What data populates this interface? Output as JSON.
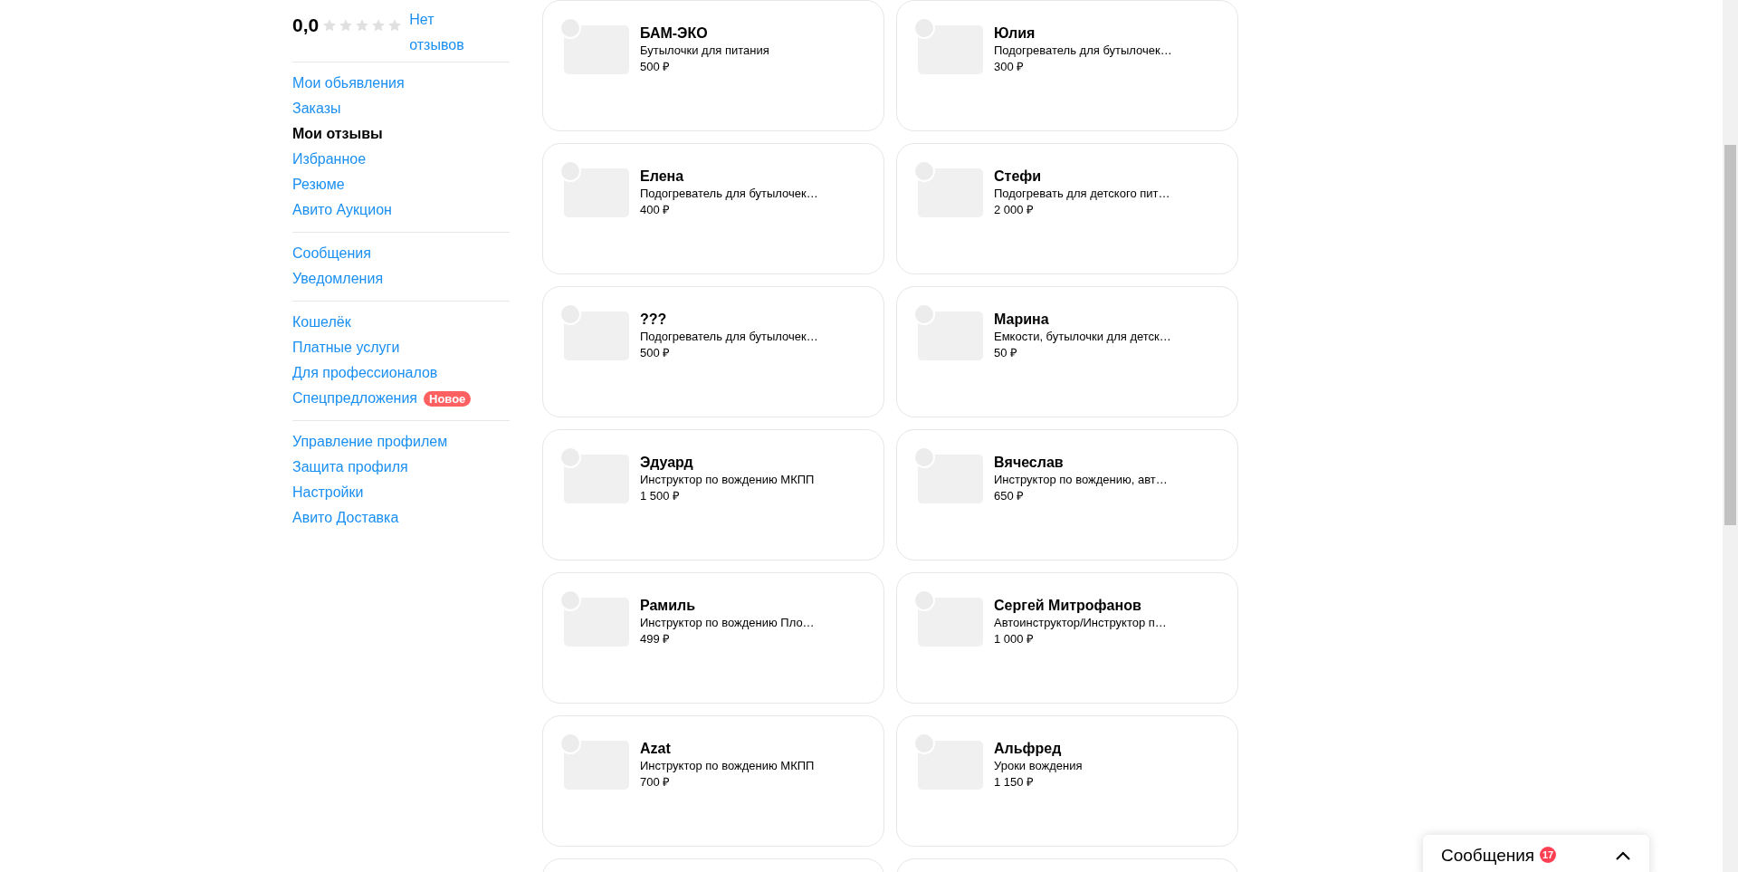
{
  "profile": {
    "rating": "0,0",
    "stars": 0,
    "reviews_link": "Нет отзывов"
  },
  "menu_groups": [
    {
      "items": [
        {
          "label": "Мои обьявления",
          "selected": false
        },
        {
          "label": "Заказы",
          "selected": false
        },
        {
          "label": "Мои отзывы",
          "selected": true
        },
        {
          "label": "Избранное",
          "selected": false
        },
        {
          "label": "Резюме",
          "selected": false
        },
        {
          "label": "Авито Аукцион",
          "selected": false
        }
      ]
    },
    {
      "items": [
        {
          "label": "Сообщения",
          "selected": false
        },
        {
          "label": "Уведомления",
          "selected": false
        }
      ]
    },
    {
      "items": [
        {
          "label": "Кошелёк",
          "selected": false
        },
        {
          "label": "Платные услуги",
          "selected": false
        },
        {
          "label": "Для профессионалов",
          "selected": false
        },
        {
          "label": "Спецпредложения",
          "selected": false,
          "badge": "Новое"
        }
      ]
    },
    {
      "items": [
        {
          "label": "Управление профилем",
          "selected": false
        },
        {
          "label": "Защита профиля",
          "selected": false
        },
        {
          "label": "Настройки",
          "selected": false
        },
        {
          "label": "Авито Доставка",
          "selected": false
        }
      ]
    }
  ],
  "deals": [
    {
      "name": "БАМ-ЭКО",
      "item": "Бутылочки для питания",
      "price": "500 ₽"
    },
    {
      "name": "Юлия",
      "item": "Подогреватель для бутылочек…",
      "price": "300 ₽"
    },
    {
      "name": "Елена",
      "item": "Подогреватель для бутылочек…",
      "price": "400 ₽"
    },
    {
      "name": "Стефи",
      "item": "Подогревать для детского пит…",
      "price": "2 000 ₽"
    },
    {
      "name": "???",
      "item": "Подогреватель для бутылочек…",
      "price": "500 ₽"
    },
    {
      "name": "Марина",
      "item": "Емкости, бутылочки для детск…",
      "price": "50 ₽"
    },
    {
      "name": "Эдуард",
      "item": "Инструктор по вождению МКПП",
      "price": "1 500 ₽"
    },
    {
      "name": "Вячеслав",
      "item": "Инструктор по вождению, авт…",
      "price": "650 ₽"
    },
    {
      "name": "Рамиль",
      "item": "Инструктор по вождению Пло…",
      "price": "499 ₽"
    },
    {
      "name": "Сергей Митрофанов",
      "item": "Автоинструктор/Инструктор п…",
      "price": "1 000 ₽"
    },
    {
      "name": "Azat",
      "item": "Инструктор по вождению МКПП",
      "price": "700 ₽"
    },
    {
      "name": "Альфред",
      "item": "Уроки вождения",
      "price": "1 150 ₽"
    }
  ],
  "messenger": {
    "title": "Сообщения",
    "unread": "17"
  }
}
